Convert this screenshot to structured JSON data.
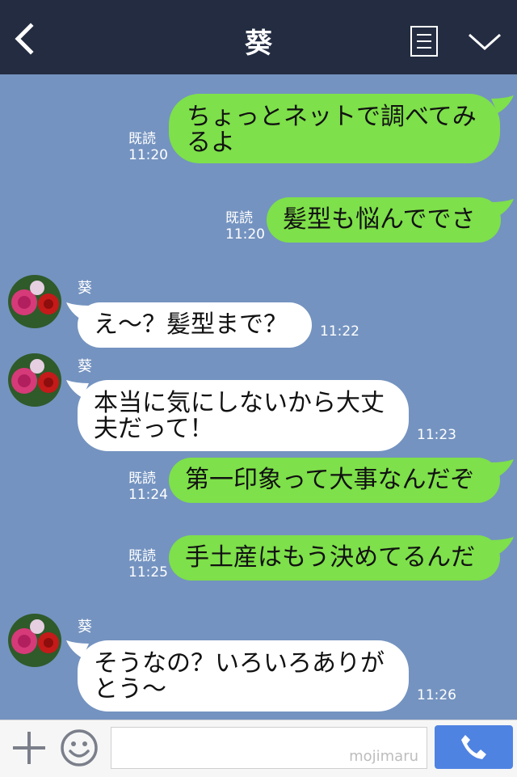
{
  "header": {
    "title": "葵"
  },
  "contact": {
    "name": "葵"
  },
  "messages": [
    {
      "id": 0,
      "from": "me",
      "text": "ちょっとネットで調べてみるよ",
      "read": "既読",
      "time": "11:20"
    },
    {
      "id": 1,
      "from": "me",
      "text": "髪型も悩んででさ",
      "read": "既読",
      "time": "11:20"
    },
    {
      "id": 2,
      "from": "them",
      "sender": "葵",
      "text": "え〜？髪型まで？",
      "time": "11:22"
    },
    {
      "id": 3,
      "from": "them",
      "sender": "葵",
      "text": "本当に気にしないから大丈夫だって！",
      "time": "11:23"
    },
    {
      "id": 4,
      "from": "me",
      "text": "第一印象って大事なんだぞ",
      "read": "既読",
      "time": "11:24"
    },
    {
      "id": 5,
      "from": "me",
      "text": "手土産はもう決めてるんだ",
      "read": "既読",
      "time": "11:25"
    },
    {
      "id": 6,
      "from": "them",
      "sender": "葵",
      "text": "そうなの？いろいろありがとう〜",
      "time": "11:26"
    }
  ],
  "composer": {
    "watermark": "mojimaru",
    "icons": {
      "plus": "plus-icon",
      "emoji": "smile-icon",
      "call": "phone-icon"
    }
  },
  "colors": {
    "header_bg": "#232c41",
    "chat_bg": "#7493c0",
    "my_bubble": "#7ee04a",
    "their_bubble": "#ffffff",
    "call_button": "#4f83e2"
  }
}
